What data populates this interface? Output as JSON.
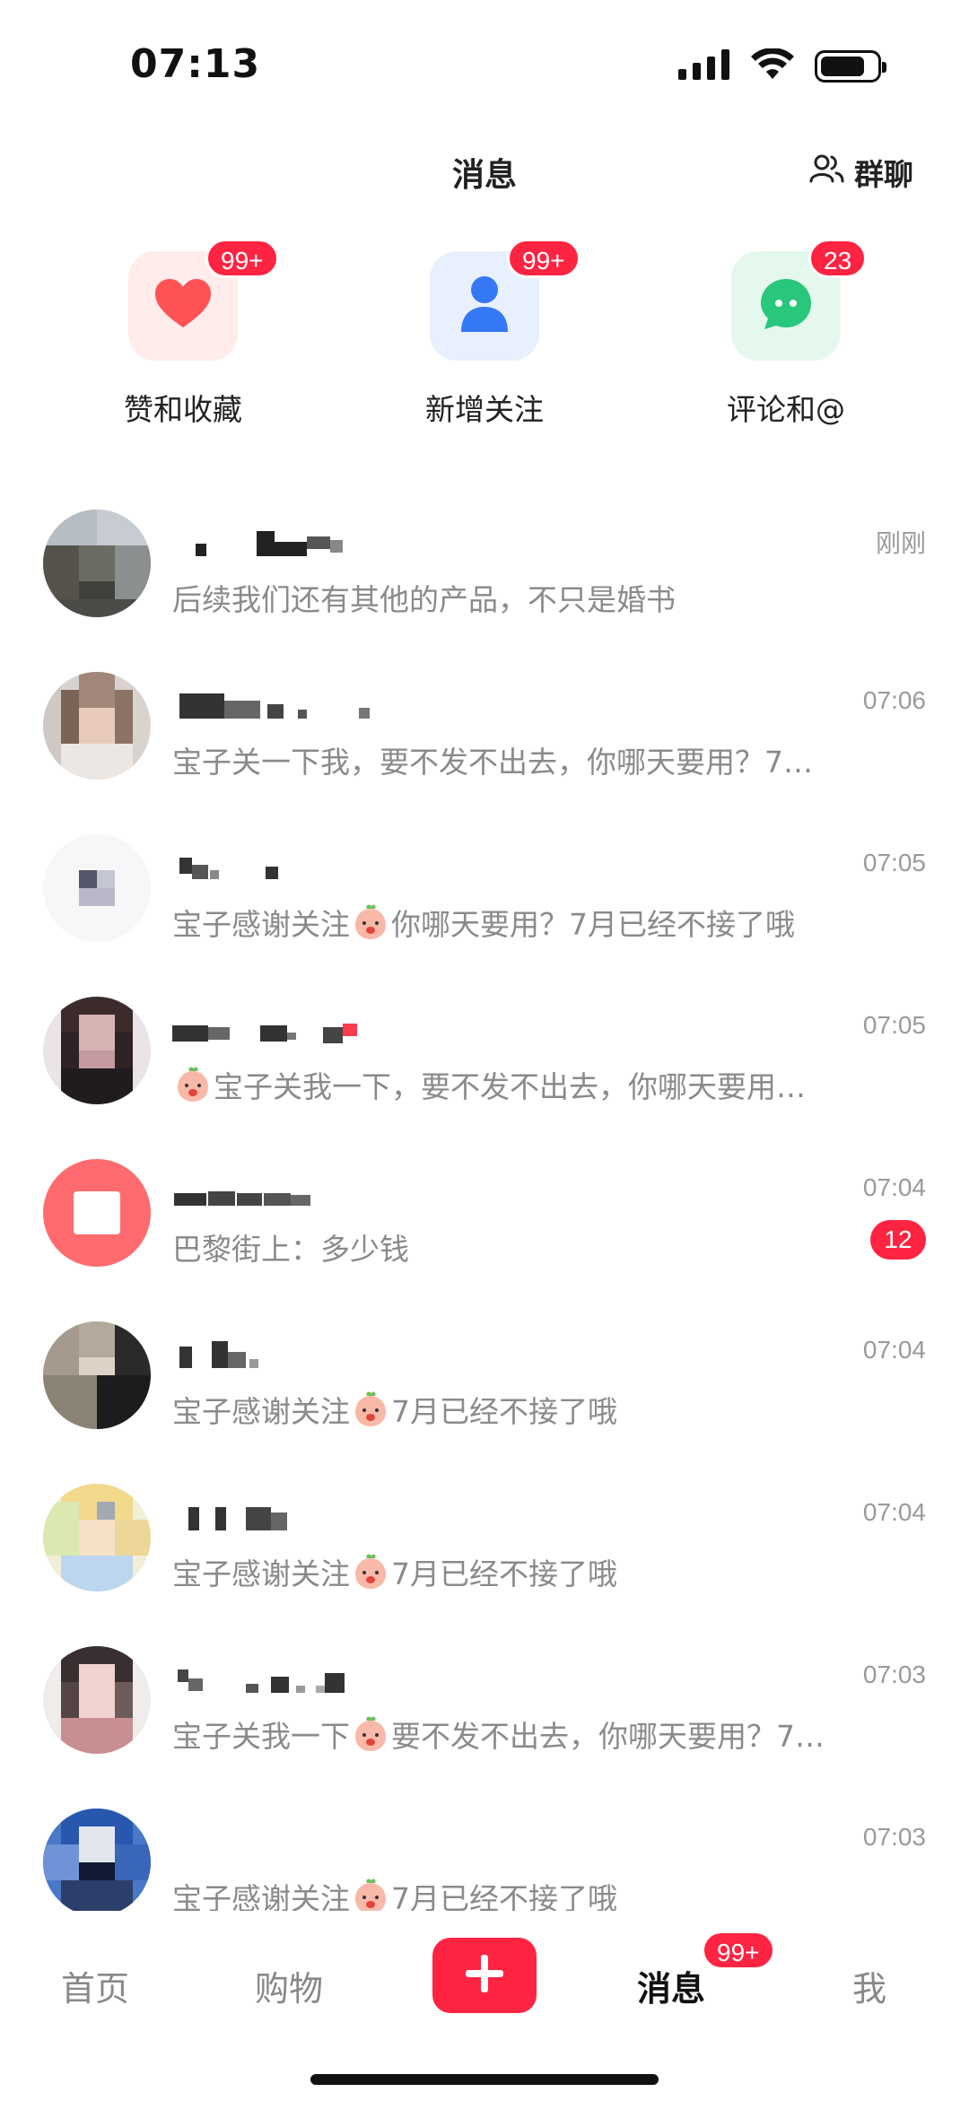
{
  "status_bar": {
    "time": "07:13"
  },
  "header": {
    "title": "消息",
    "group_chat_label": "群聊"
  },
  "shortcuts": [
    {
      "label": "赞和收藏",
      "badge": "99+",
      "icon": "heart-icon",
      "bg": "#fff0f0",
      "color": "#ff4d4f"
    },
    {
      "label": "新增关注",
      "badge": "99+",
      "icon": "person-icon",
      "bg": "#eef4ff",
      "color": "#3b82f6"
    },
    {
      "label": "评论和@",
      "badge": "23",
      "icon": "comment-icon",
      "bg": "#eafaf2",
      "color": "#2fcf86"
    }
  ],
  "messages": [
    {
      "time": "刚刚",
      "preview": "后续我们还有其他的产品，不只是婚书"
    },
    {
      "time": "07:06",
      "preview": "宝子关一下我，要不发不出去，你哪天要用？7…"
    },
    {
      "time": "07:05",
      "preview_a": "宝子感谢关注",
      "preview_b": "你哪天要用？7月已经不接了哦"
    },
    {
      "time": "07:05",
      "preview": "宝子关我一下，要不发不出去，你哪天要用…"
    },
    {
      "time": "07:04",
      "preview": "巴黎街上：多少钱",
      "unread": "12"
    },
    {
      "time": "07:04",
      "preview_a": "宝子感谢关注",
      "preview_b": "7月已经不接了哦"
    },
    {
      "time": "07:04",
      "preview_a": "宝子感谢关注",
      "preview_b": "7月已经不接了哦"
    },
    {
      "time": "07:03",
      "preview_a": "宝子关我一下",
      "preview_b": "要不发不出去，你哪天要用？7…"
    },
    {
      "time": "07:03",
      "preview_a": "宝子感谢关注",
      "preview_b": "7月已经不接了哦"
    }
  ],
  "tabs": {
    "home": "首页",
    "shop": "购物",
    "messages": "消息",
    "messages_badge": "99+",
    "me": "我"
  },
  "colors": {
    "accent": "#ff2442"
  }
}
